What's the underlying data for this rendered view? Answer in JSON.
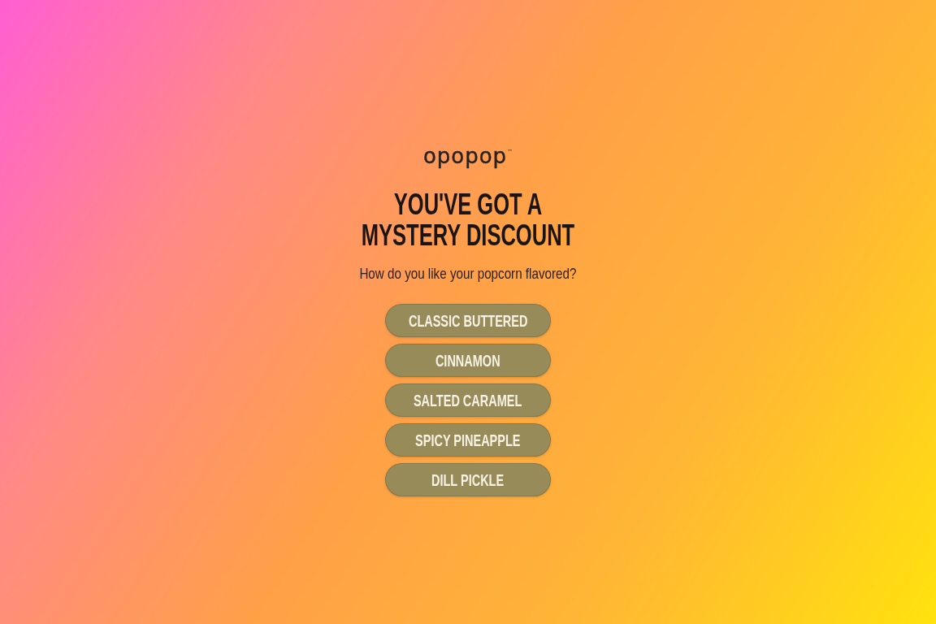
{
  "logo": "opopop$^{™}$",
  "title": "YOU'VE GOT A MYSTERY DISCOUNT",
  "question": "How do you like your popcorn flavored?",
  "options": [
    {
      "label": "CLASSIC BUTTERED",
      "selected": false
    },
    {
      "label": "CINNAMON",
      "selected": false
    },
    {
      "label": "SALTED CARAMEL",
      "selected": false
    },
    {
      "label": "SPICY PINEAPPLE",
      "selected": false
    },
    {
      "label": "DILL PICKLE",
      "selected": false
    }
  ]
}
